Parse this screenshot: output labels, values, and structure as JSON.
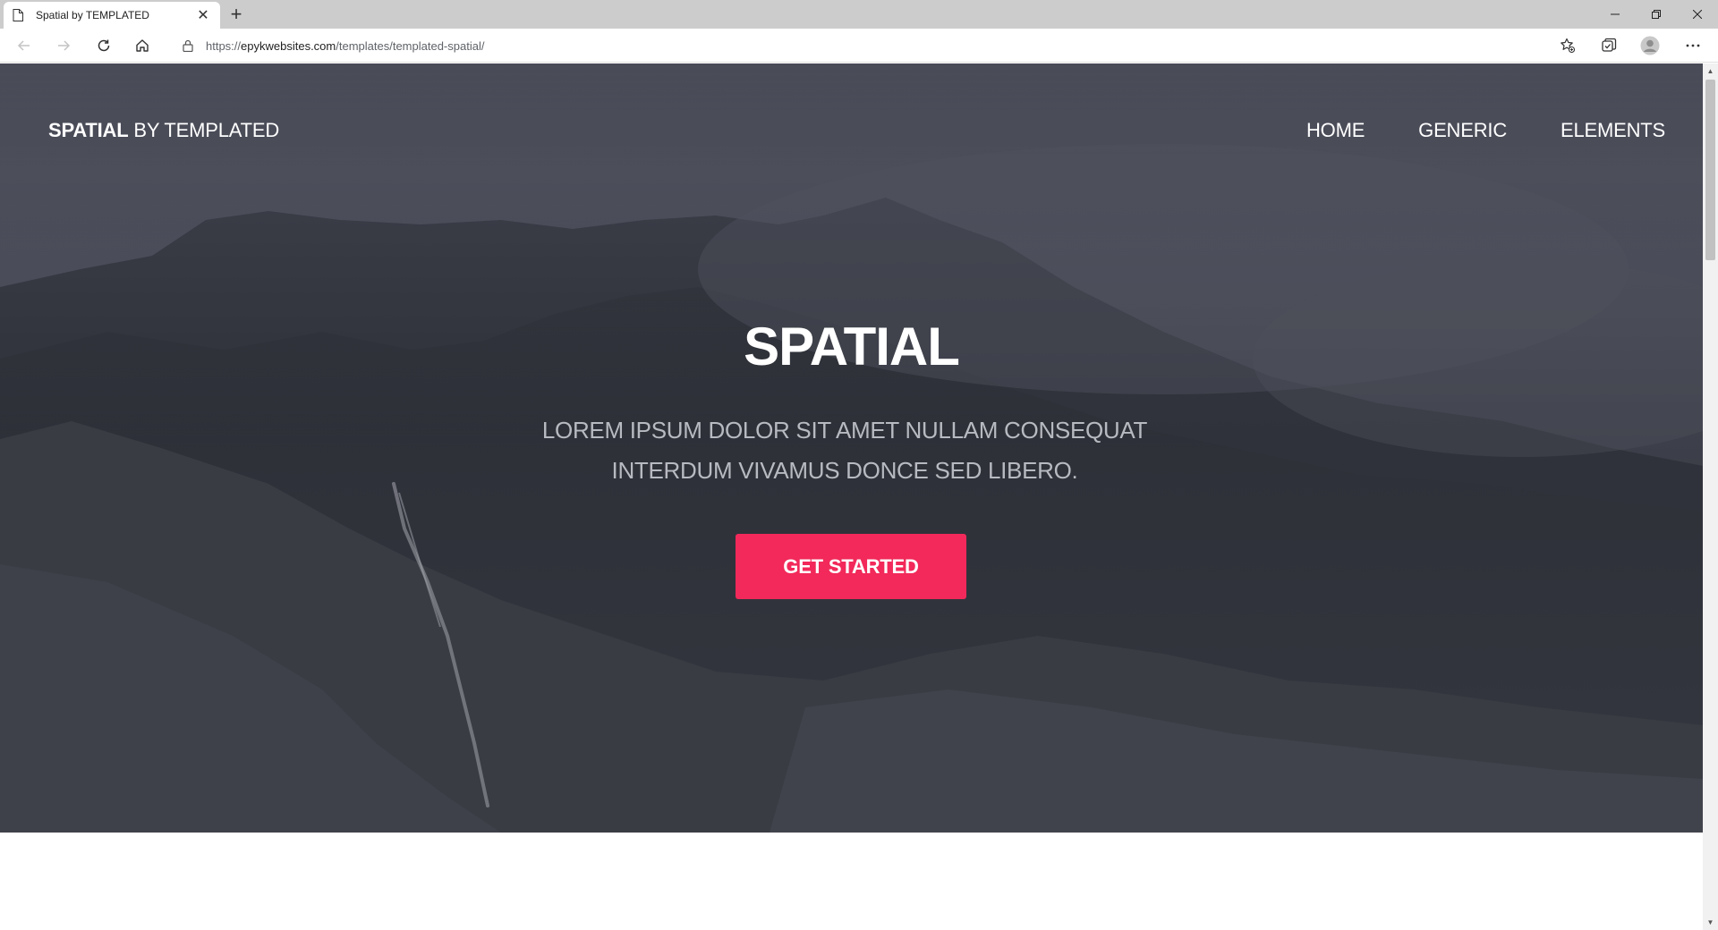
{
  "browser": {
    "tab_title": "Spatial by TEMPLATED",
    "url_prefix": "https://",
    "url_host": "epykwebsites.com",
    "url_path": "/templates/templated-spatial/"
  },
  "site": {
    "logo_bold": "SPATIAL",
    "logo_rest": " BY TEMPLATED",
    "nav": [
      "HOME",
      "GENERIC",
      "ELEMENTS"
    ]
  },
  "hero": {
    "title": "SPATIAL",
    "subtitle_line1": "LOREM IPSUM DOLOR SIT AMET NULLAM CONSEQUAT",
    "subtitle_line2": "INTERDUM VIVAMUS DONCE SED LIBERO.",
    "cta_label": "GET STARTED"
  },
  "colors": {
    "accent": "#f2295a",
    "hero_overlay": "#3a3c46"
  },
  "icons": {
    "tab": "page-icon",
    "back": "arrow-left-icon",
    "forward": "arrow-right-icon",
    "reload": "reload-icon",
    "home": "home-icon",
    "lock": "lock-icon",
    "favorite": "star-add-icon",
    "collections": "collections-icon",
    "profile": "profile-icon",
    "menu": "more-icon"
  }
}
